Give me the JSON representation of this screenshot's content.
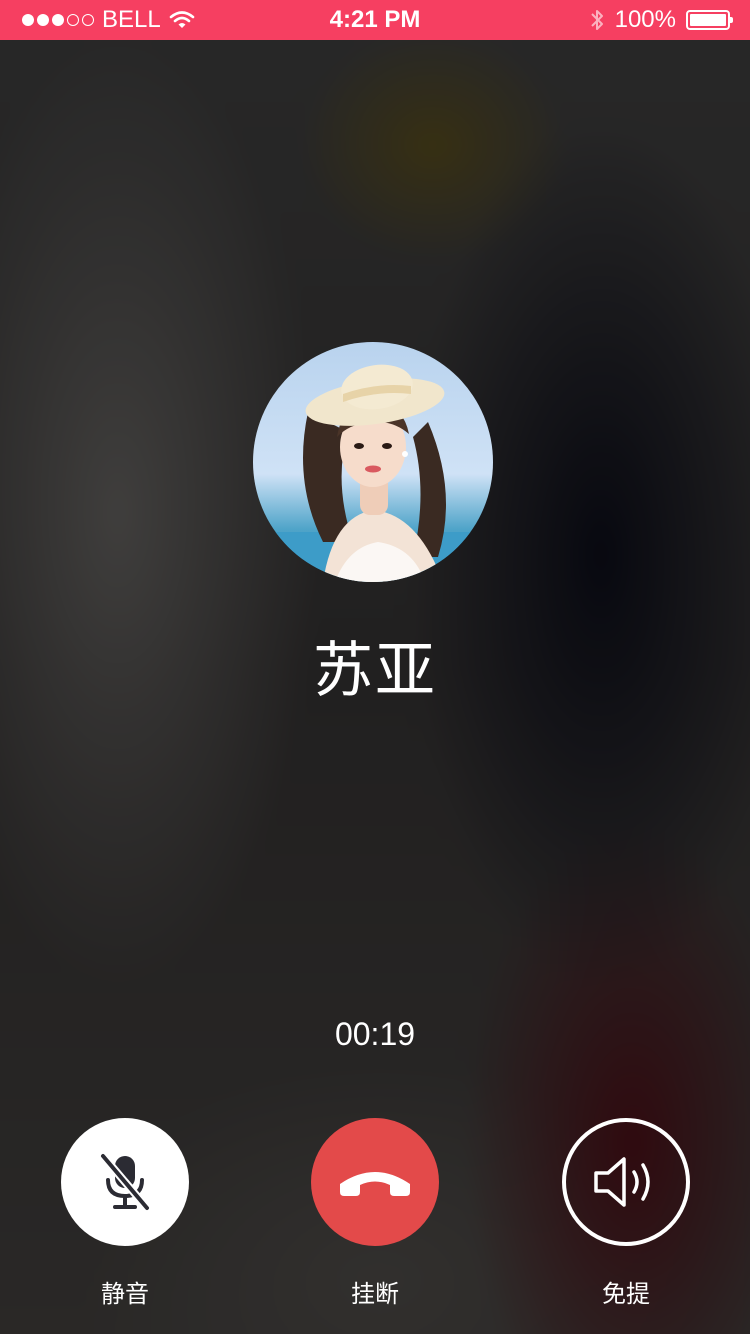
{
  "status_bar": {
    "carrier": "BELL",
    "time": "4:21 PM",
    "battery": "100%",
    "background_color": "#f63f61"
  },
  "caller": {
    "name": "苏亚",
    "avatar_icon": "contact-photo"
  },
  "call": {
    "duration": "00:19"
  },
  "controls": {
    "mute_label": "静音",
    "hangup_label": "挂断",
    "speaker_label": "免提",
    "hangup_color": "#e34a4a"
  }
}
